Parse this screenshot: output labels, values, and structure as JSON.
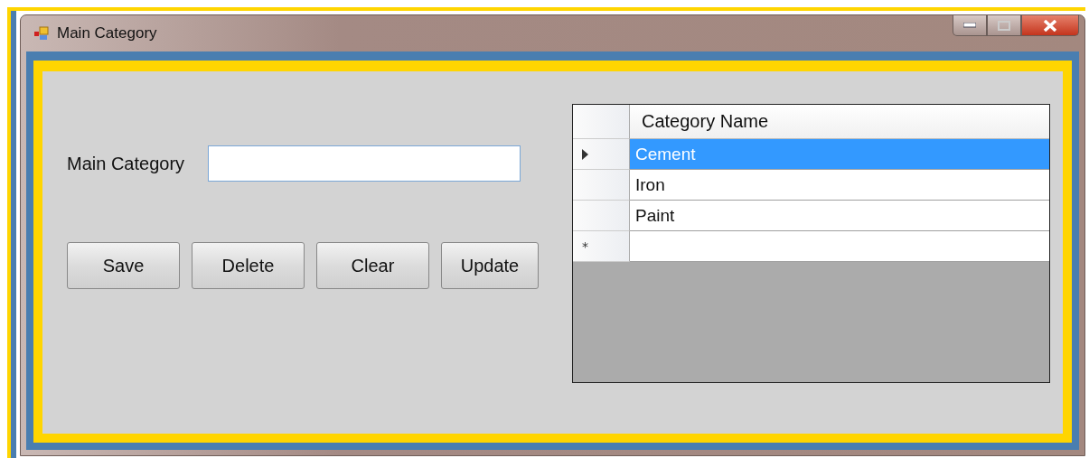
{
  "window": {
    "title": "Main Category"
  },
  "form": {
    "label": "Main Category"
  },
  "buttons": [
    "Save",
    "Delete",
    "Clear",
    "Update"
  ],
  "grid": {
    "columns": [
      "Category Name"
    ],
    "rows": [
      {
        "kind": "data",
        "cells": [
          "Cement"
        ],
        "selected": true
      },
      {
        "kind": "data",
        "cells": [
          "Iron"
        ],
        "selected": false
      },
      {
        "kind": "data",
        "cells": [
          "Paint"
        ],
        "selected": false
      },
      {
        "kind": "new",
        "marker": "*",
        "selected": false
      }
    ]
  }
}
